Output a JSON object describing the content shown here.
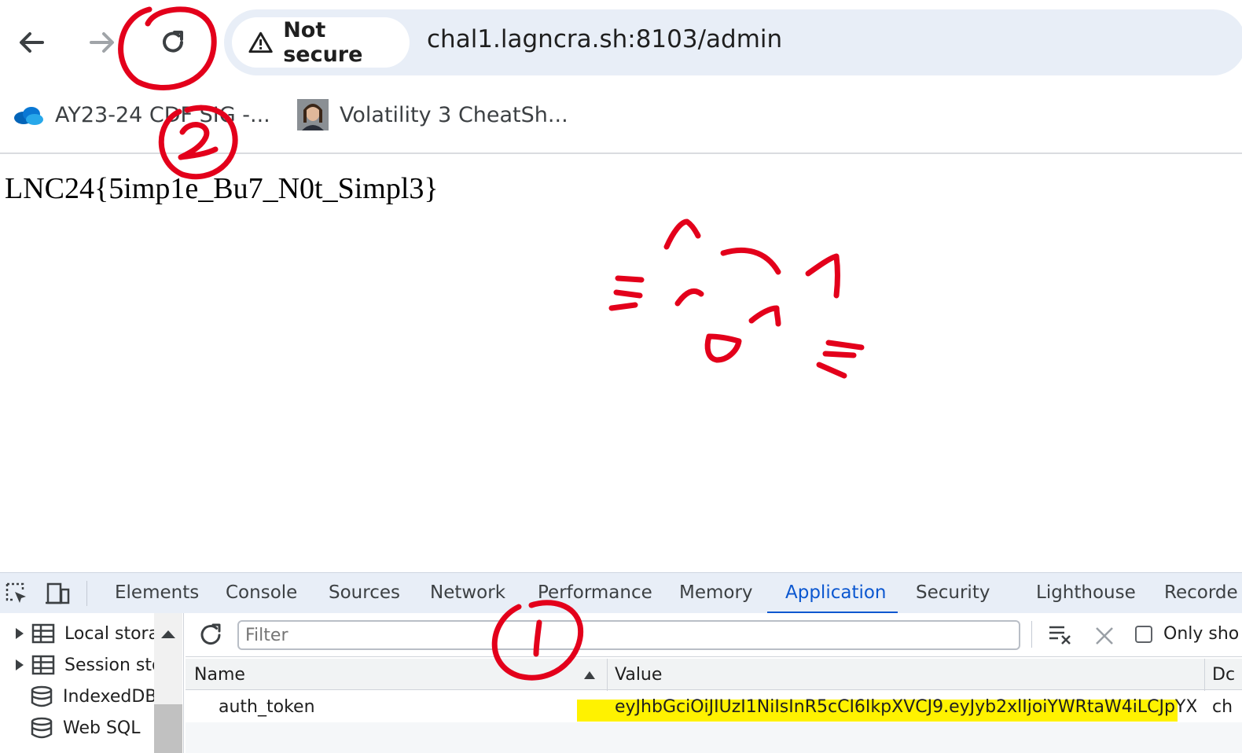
{
  "browser": {
    "security_chip": "Not secure",
    "url": "chal1.lagncra.sh:8103/admin"
  },
  "bookmarks": [
    {
      "label": "AY23-24 CDF SIG -...",
      "icon": "onedrive-cloud-icon"
    },
    {
      "label": "Volatility 3 CheatSh...",
      "icon": "avatar-favicon"
    }
  ],
  "page": {
    "flag": "LNC24{5imp1e_Bu7_N0t_Simpl3}"
  },
  "annotations": {
    "marker_1": "1",
    "marker_2": "2",
    "color": "#e3001b"
  },
  "devtools": {
    "tabs": [
      "Elements",
      "Console",
      "Sources",
      "Network",
      "Performance",
      "Memory",
      "Application",
      "Security",
      "Lighthouse",
      "Recorde"
    ],
    "active_tab": "Application",
    "sidebar": [
      "Local stora",
      "Session sto",
      "IndexedDB",
      "Web SQL"
    ],
    "filter_placeholder": "Filter",
    "only_show_label": "Only sho",
    "columns": {
      "name": "Name",
      "value": "Value",
      "domain": "Dc"
    },
    "rows": [
      {
        "name": "auth_token",
        "value": "eyJhbGciOiJIUzI1NiIsInR5cCI6IkpXVCJ9.eyJyb2xlIjoiYWRtaW4iLCJpYX...",
        "domain": "ch"
      }
    ],
    "accent_color": "#0b57d0",
    "highlight_color": "#fff200"
  }
}
